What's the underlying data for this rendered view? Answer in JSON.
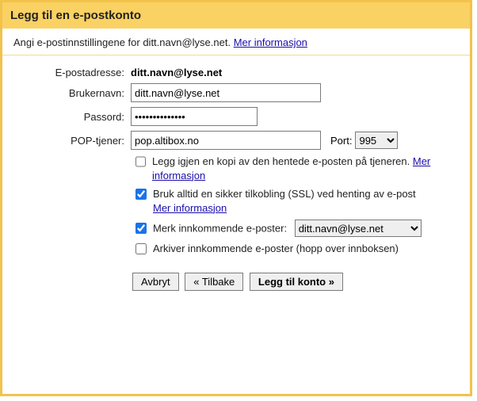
{
  "dialog": {
    "title": "Legg til en e-postkonto"
  },
  "subheader": {
    "prefix": "Angi e-postinnstillingene for ",
    "email": "ditt.navn@lyse.net",
    "suffix": ". ",
    "more_info": "Mer informasjon"
  },
  "labels": {
    "email": "E-postadresse:",
    "username": "Brukernavn:",
    "password": "Passord:",
    "pop_server": "POP-tjener:",
    "port": "Port:"
  },
  "fields": {
    "email_value": "ditt.navn@lyse.net",
    "username_value": "ditt.navn@lyse.net",
    "password_value": "••••••••••••••",
    "pop_server_value": "pop.altibox.no",
    "port_value": "995",
    "domain_selected": "ditt.navn@lyse.net"
  },
  "checkboxes": {
    "leave_copy": {
      "text": "Legg igjen en kopi av den hentede e-posten på tjeneren. ",
      "link": "Mer informasjon"
    },
    "ssl": {
      "text": "Bruk alltid en sikker tilkobling (SSL) ved henting av e-post ",
      "link": "Mer informasjon"
    },
    "label_incoming": {
      "text": "Merk innkommende e-poster:"
    },
    "archive": {
      "text": "Arkiver innkommende e-poster (hopp over innboksen)"
    }
  },
  "buttons": {
    "cancel": "Avbryt",
    "back": "« Tilbake",
    "add": "Legg til konto »"
  }
}
